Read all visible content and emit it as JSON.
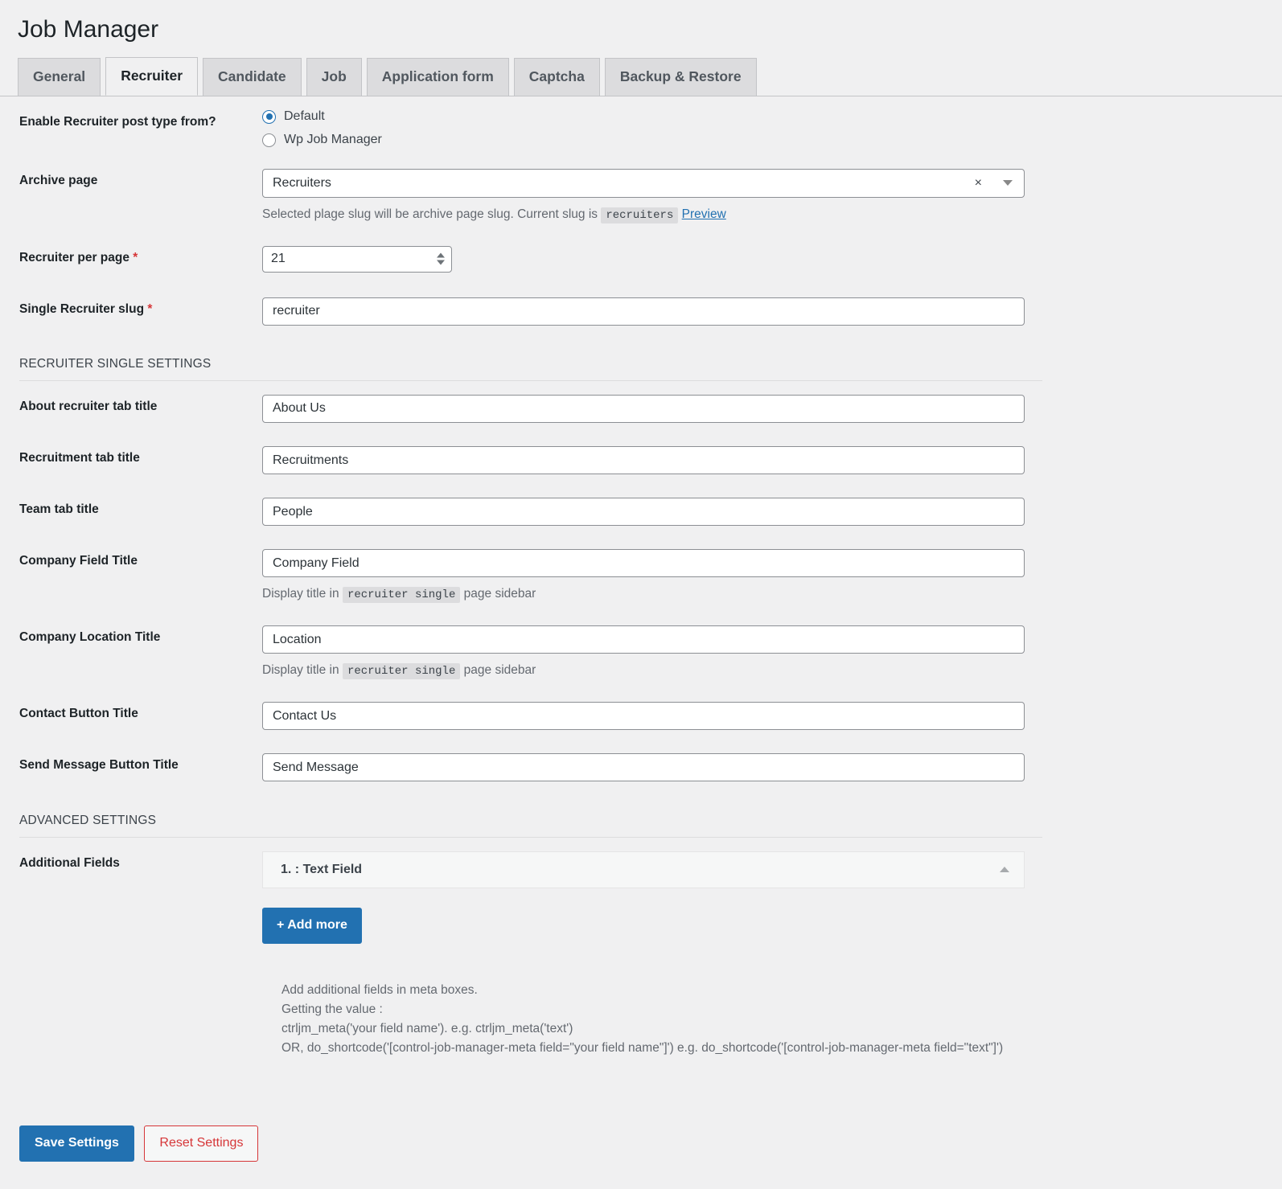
{
  "header": {
    "title": "Job Manager"
  },
  "tabs": [
    {
      "label": "General",
      "active": false
    },
    {
      "label": "Recruiter",
      "active": true
    },
    {
      "label": "Candidate",
      "active": false
    },
    {
      "label": "Job",
      "active": false
    },
    {
      "label": "Application form",
      "active": false
    },
    {
      "label": "Captcha",
      "active": false
    },
    {
      "label": "Backup & Restore",
      "active": false
    }
  ],
  "fields": {
    "post_type_from": {
      "label": "Enable Recruiter post type from?",
      "options": [
        {
          "label": "Default",
          "selected": true
        },
        {
          "label": "Wp Job Manager",
          "selected": false
        }
      ]
    },
    "archive_page": {
      "label": "Archive page",
      "value": "Recruiters",
      "clear_icon": "×",
      "help_prefix": "Selected plage slug will be archive page slug. Current slug is",
      "help_code": "recruiters",
      "help_link": "Preview"
    },
    "recruiter_per_page": {
      "label": "Recruiter per page",
      "required_mark": "*",
      "value": "21"
    },
    "single_recruiter_slug": {
      "label": "Single Recruiter slug",
      "required_mark": "*",
      "value": "recruiter"
    },
    "about_tab_title": {
      "label": "About recruiter tab title",
      "value": "About Us"
    },
    "recruitment_tab_title": {
      "label": "Recruitment tab title",
      "value": "Recruitments"
    },
    "team_tab_title": {
      "label": "Team tab title",
      "value": "People"
    },
    "company_field_title": {
      "label": "Company Field Title",
      "value": "Company Field",
      "help_prefix": "Display title in",
      "help_code": "recruiter single",
      "help_suffix": "page sidebar"
    },
    "company_location_title": {
      "label": "Company Location Title",
      "value": "Location",
      "help_prefix": "Display title in",
      "help_code": "recruiter single",
      "help_suffix": "page sidebar"
    },
    "contact_button_title": {
      "label": "Contact Button Title",
      "value": "Contact Us"
    },
    "send_message_button_title": {
      "label": "Send Message Button Title",
      "value": "Send Message"
    },
    "additional_fields": {
      "label": "Additional Fields",
      "item_title": "1. : Text Field",
      "add_more_label": "+ Add more"
    }
  },
  "sections": {
    "recruiter_single": "RECRUITER SINGLE SETTINGS",
    "advanced": "ADVANCED SETTINGS"
  },
  "help_text": {
    "line1": "Add additional fields in meta boxes.",
    "line2": "Getting the value :",
    "line3": "ctrljm_meta('your field name'). e.g. ctrljm_meta('text')",
    "line4": "OR, do_shortcode('[control-job-manager-meta field=\"your field name\"]') e.g. do_shortcode('[control-job-manager-meta field=\"text\"]')"
  },
  "footer": {
    "save_label": "Save Settings",
    "reset_label": "Reset Settings"
  },
  "colors": {
    "primary": "#2271b1",
    "danger": "#d63638",
    "background": "#f0f0f1"
  }
}
